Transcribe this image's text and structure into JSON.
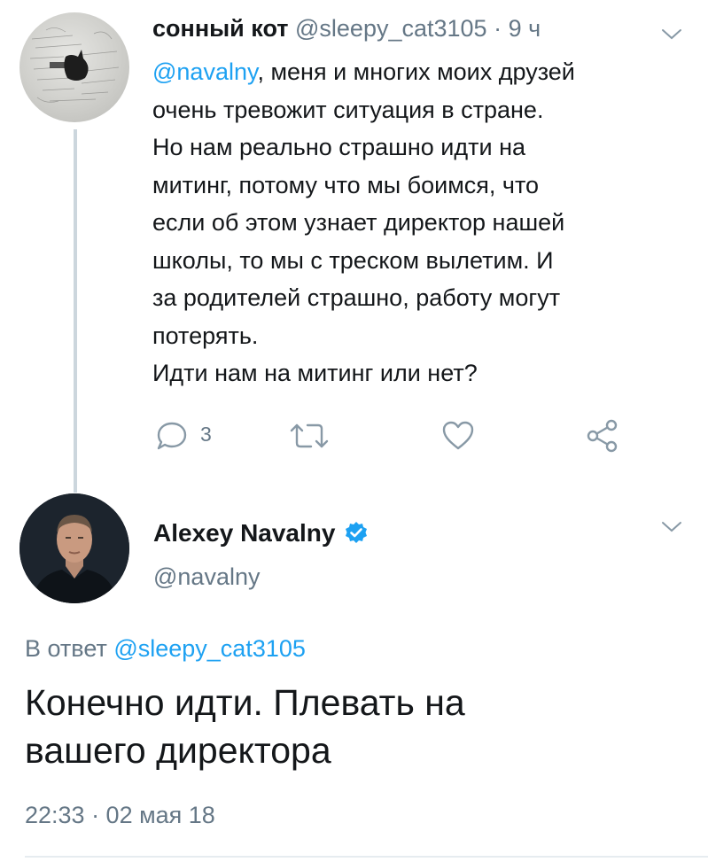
{
  "tweet1": {
    "name": "сонный кот",
    "handle": "@sleepy_cat3105",
    "separator": "·",
    "time": "9 ч",
    "avatar_icon": "cat-drawing-avatar",
    "mention": "@navalny",
    "lines": [
      ", меня и многих моих друзей",
      "очень тревожит ситуация в стране.",
      "Но нам реально страшно идти на",
      "митинг, потому что мы боимся, что",
      "если об этом узнает директор нашей",
      "школы, то мы с треском вылетим. И",
      "за родителей страшно, работу могут",
      "потерять.",
      "Идти нам на митинг или нет?"
    ],
    "reply_count": "3",
    "icons": {
      "reply": "reply-icon",
      "retweet": "retweet-icon",
      "like": "heart-icon",
      "share": "share-icon",
      "menu": "chevron-down-icon"
    }
  },
  "tweet2": {
    "name": "Alexey Navalny",
    "handle": "@navalny",
    "verified_icon": "verified-badge-icon",
    "avatar_icon": "profile-photo-avatar",
    "replying_prefix": "В ответ ",
    "replying_to": "@sleepy_cat3105",
    "lines": [
      "Конечно идти. Плевать на",
      "вашего директора"
    ],
    "timestamp": "22:33 · 02 мая 18"
  },
  "colors": {
    "accent": "#1da1f2",
    "secondary_text": "#657786",
    "primary_text": "#14171a",
    "thread_line": "#ccd6dd",
    "divider": "#e6ecf0"
  }
}
